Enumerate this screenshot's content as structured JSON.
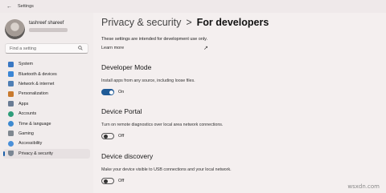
{
  "window": {
    "title": "Settings"
  },
  "user": {
    "name": "tashreef shareef"
  },
  "search": {
    "placeholder": "Find a setting"
  },
  "sidebar": {
    "items": [
      {
        "label": "System",
        "icon": "monitor-icon",
        "color": "#3a78c3"
      },
      {
        "label": "Bluetooth & devices",
        "icon": "bluetooth-icon",
        "color": "#3b86d6"
      },
      {
        "label": "Network & internet",
        "icon": "wifi-icon",
        "color": "#4f7fb5"
      },
      {
        "label": "Personalization",
        "icon": "brush-icon",
        "color": "#c97a2e"
      },
      {
        "label": "Apps",
        "icon": "apps-icon",
        "color": "#6a7c94"
      },
      {
        "label": "Accounts",
        "icon": "person-icon",
        "color": "#2f9d7a"
      },
      {
        "label": "Time & language",
        "icon": "globe-clock-icon",
        "color": "#3e8ad0"
      },
      {
        "label": "Gaming",
        "icon": "controller-icon",
        "color": "#808890"
      },
      {
        "label": "Accessibility",
        "icon": "accessibility-icon",
        "color": "#4a90d9"
      },
      {
        "label": "Privacy & security",
        "icon": "shield-icon",
        "color": "#7b8794",
        "active": true
      }
    ]
  },
  "breadcrumb": {
    "parent": "Privacy & security",
    "separator": ">",
    "current": "For developers"
  },
  "intro": "These settings are intended for development use only.",
  "learn_more": "Learn more",
  "sections": {
    "developer_mode": {
      "title": "Developer Mode",
      "desc": "Install apps from any source, including loose files.",
      "state": "On"
    },
    "device_portal": {
      "title": "Device Portal",
      "desc": "Turn on remote diagnostics over local area network connections.",
      "state": "Off"
    },
    "device_discovery": {
      "title": "Device discovery",
      "desc": "Make your device visible to USB connections and your local network.",
      "state": "Off"
    }
  },
  "watermark": "wsxdn.com",
  "accent": "#1f5a96"
}
